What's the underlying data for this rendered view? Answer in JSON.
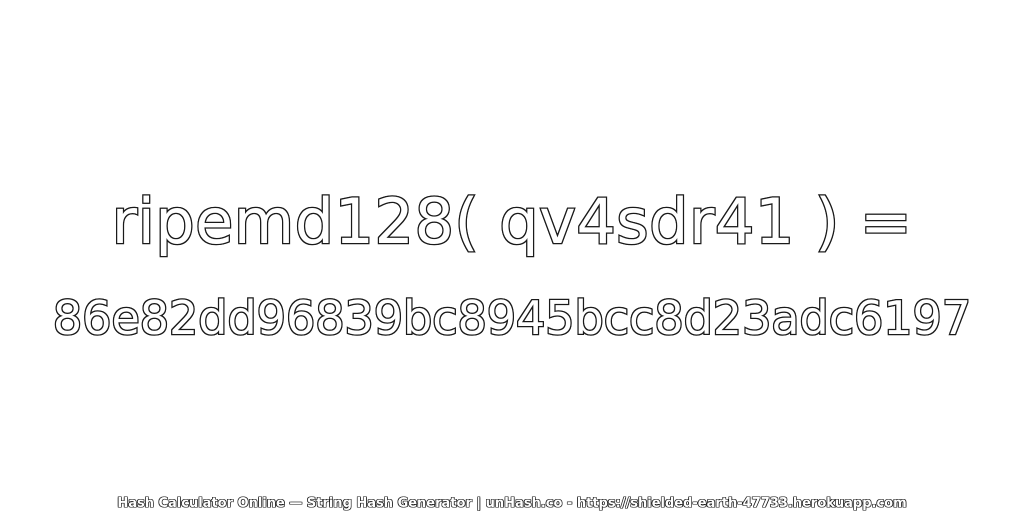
{
  "hash_expression": "ripemd128( qv4sdr41 ) =",
  "hash_result": "86e82dd96839bc8945bcc8d23adc6197",
  "footer_text": "Hash Calculator Online — String Hash Generator | unHash.co - https://shielded-earth-47733.herokuapp.com",
  "colors": {
    "background": "#ffffff",
    "text_fill": "#ffffff",
    "text_outline": "#1a1a1a"
  }
}
